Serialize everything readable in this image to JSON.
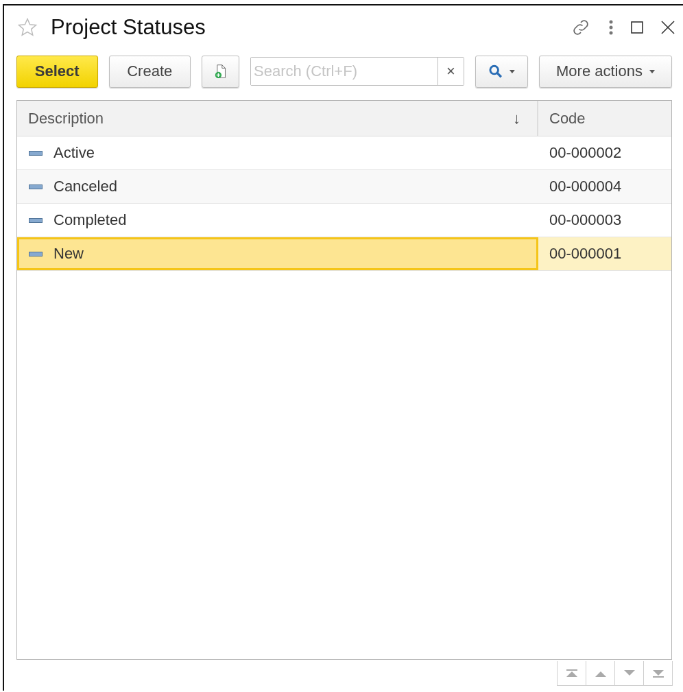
{
  "window": {
    "title": "Project Statuses",
    "favorite": false
  },
  "toolbar": {
    "select_button": "Select",
    "create_button": "Create",
    "search": {
      "placeholder": "Search (Ctrl+F)",
      "clear": "×"
    },
    "more_actions": "More actions"
  },
  "table": {
    "columns": [
      {
        "label": "Description",
        "sort": "↓"
      },
      {
        "label": "Code"
      }
    ],
    "rows": [
      {
        "description": "Active",
        "code": "00-000002",
        "selected": false
      },
      {
        "description": "Canceled",
        "code": "00-000004",
        "selected": false
      },
      {
        "description": "Completed",
        "code": "00-000003",
        "selected": false
      },
      {
        "description": "New",
        "code": "00-000001",
        "selected": true
      }
    ]
  }
}
